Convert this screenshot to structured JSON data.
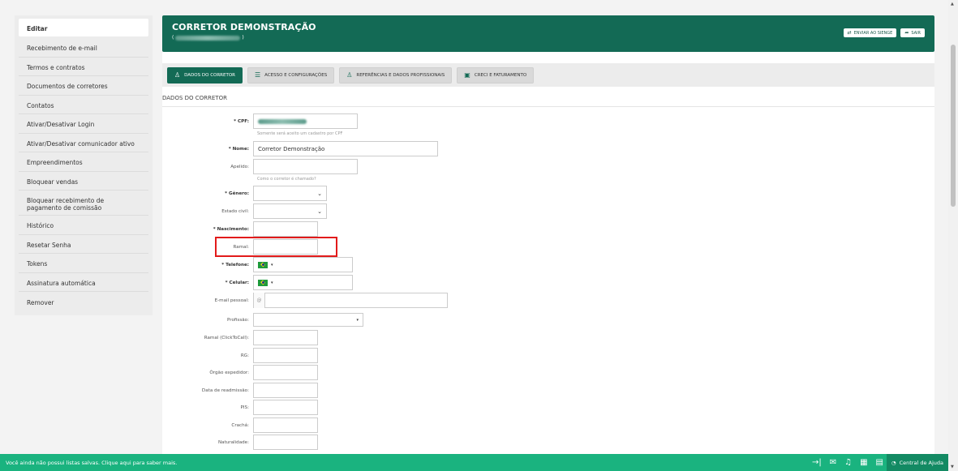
{
  "sidebar": {
    "items": [
      {
        "label": "Editar"
      },
      {
        "label": "Recebimento de e-mail"
      },
      {
        "label": "Termos e contratos"
      },
      {
        "label": "Documentos de corretores"
      },
      {
        "label": "Contatos"
      },
      {
        "label": "Ativar/Desativar Login"
      },
      {
        "label": "Ativar/Desativar comunicador ativo"
      },
      {
        "label": "Empreendimentos"
      },
      {
        "label": "Bloquear vendas"
      },
      {
        "label": "Bloquear recebimento de pagamento de comissão"
      },
      {
        "label": "Histórico"
      },
      {
        "label": "Resetar Senha"
      },
      {
        "label": "Tokens"
      },
      {
        "label": "Assinatura automática"
      },
      {
        "label": "Remover"
      }
    ]
  },
  "header": {
    "title": "CORRETOR DEMONSTRAÇÃO",
    "sub_open": "(",
    "sub_close": ")",
    "btn_send": "ENVIAR AO SIENGE",
    "btn_exit": "SAIR"
  },
  "tabs": [
    {
      "label": "DADOS DO CORRETOR",
      "icon": "person-icon"
    },
    {
      "label": "ACESSO E CONFIGURAÇÕES",
      "icon": "sliders-icon"
    },
    {
      "label": "REFERÊNCIAS E DADOS PROFISSIONAIS",
      "icon": "person-pin-icon"
    },
    {
      "label": "CRECI E FATURAMENTO",
      "icon": "id-card-icon"
    }
  ],
  "section_title": "DADOS DO CORRETOR",
  "form": {
    "cpf": {
      "label": "* CPF:",
      "help": "Somente será aceito um cadastro por CPF"
    },
    "nome": {
      "label": "* Nome:",
      "value": "Corretor Demonstração"
    },
    "apelido": {
      "label": "Apelido:",
      "help": "Como o corretor é chamado?"
    },
    "genero": {
      "label": "* Gênero:"
    },
    "estado_civil": {
      "label": "Estado civil:"
    },
    "nascimento": {
      "label": "* Nascimento:"
    },
    "ramal": {
      "label": "Ramal:"
    },
    "telefone": {
      "label": "* Telefone:"
    },
    "celular": {
      "label": "* Celular:"
    },
    "email": {
      "label": "E-mail pessoal:",
      "addon": "@"
    },
    "profissao": {
      "label": "Profissão:"
    },
    "ramal_click": {
      "label": "Ramal (ClickToCall):"
    },
    "rg": {
      "label": "RG:"
    },
    "orgao": {
      "label": "Órgão expedidor:"
    },
    "readmissao": {
      "label": "Data de readmissão:"
    },
    "pis": {
      "label": "PIS:"
    },
    "cracha": {
      "label": "Crachá:"
    },
    "naturalidade": {
      "label": "Naturalidade:"
    }
  },
  "footer": {
    "message": "Você ainda não possui listas salvas. Clique aqui para saber mais.",
    "help": "Central de Ajuda"
  },
  "colors": {
    "primary": "#136a55",
    "footer": "#1ab37f",
    "highlight": "#e21b1b"
  }
}
